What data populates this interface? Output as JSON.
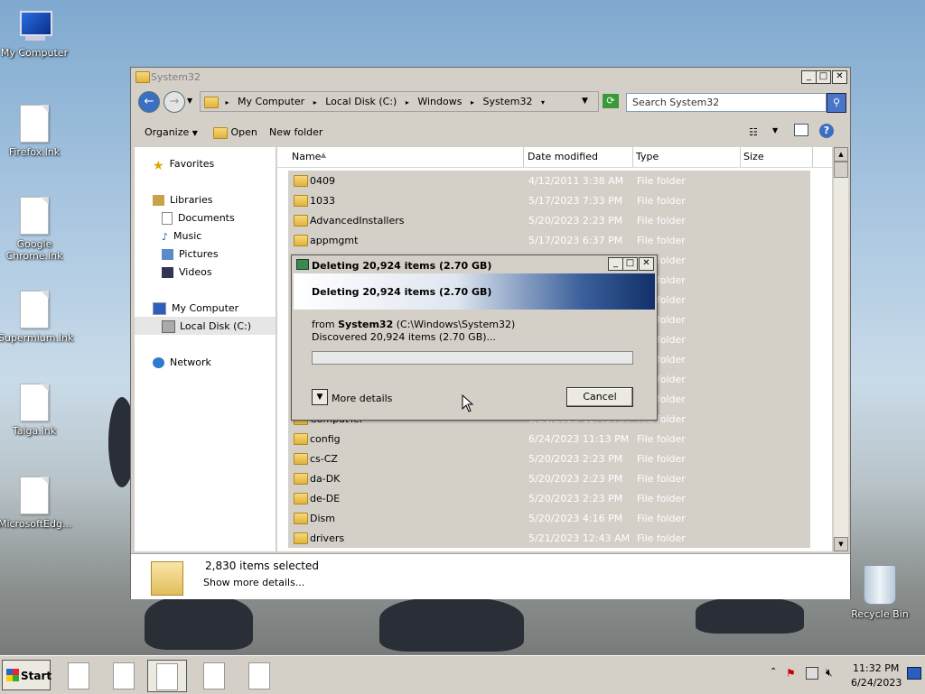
{
  "desktop": {
    "icons": [
      {
        "label": "My Computer"
      },
      {
        "label": "Firefox.lnk"
      },
      {
        "label": "Google Chrome.lnk"
      },
      {
        "label": "Supermium.lnk"
      },
      {
        "label": "Taiga.lnk"
      },
      {
        "label": "MicrosoftEdg..."
      },
      {
        "label": "Recycle Bin"
      }
    ]
  },
  "window": {
    "title": "System32",
    "controls": {
      "minimize": "_",
      "maximize": "□",
      "close": "✕"
    },
    "breadcrumb": [
      "My Computer",
      "Local Disk (C:)",
      "Windows",
      "System32"
    ],
    "search_placeholder": "Search System32",
    "toolbar": {
      "organize": "Organize",
      "open": "Open",
      "new_folder": "New folder"
    },
    "nav": {
      "favorites": "Favorites",
      "libraries": "Libraries",
      "documents": "Documents",
      "music": "Music",
      "pictures": "Pictures",
      "videos": "Videos",
      "my_computer": "My Computer",
      "local_disk": "Local Disk (C:)",
      "network": "Network"
    },
    "columns": {
      "name": "Name",
      "date": "Date modified",
      "type": "Type",
      "size": "Size"
    },
    "rows": [
      {
        "name": "0409",
        "date": "4/12/2011 3:38 AM",
        "type": "File folder"
      },
      {
        "name": "1033",
        "date": "5/17/2023 7:33 PM",
        "type": "File folder"
      },
      {
        "name": "AdvancedInstallers",
        "date": "5/20/2023 2:23 PM",
        "type": "File folder"
      },
      {
        "name": "appmgmt",
        "date": "5/17/2023 6:37 PM",
        "type": "File folder"
      },
      {
        "name": "",
        "date": "",
        "type": "File folder"
      },
      {
        "name": "",
        "date": "",
        "type": "File folder"
      },
      {
        "name": "",
        "date": "",
        "type": "File folder"
      },
      {
        "name": "",
        "date": "",
        "type": "File folder"
      },
      {
        "name": "",
        "date": "",
        "type": "File folder"
      },
      {
        "name": "",
        "date": "",
        "type": "File folder"
      },
      {
        "name": "",
        "date": "",
        "type": "File folder"
      },
      {
        "name": "",
        "date": "",
        "type": "File folder"
      },
      {
        "name": "CompatTel",
        "date": "5/21/2023 12:43 AM",
        "type": "File folder"
      },
      {
        "name": "config",
        "date": "6/24/2023 11:13 PM",
        "type": "File folder"
      },
      {
        "name": "cs-CZ",
        "date": "5/20/2023 2:23 PM",
        "type": "File folder"
      },
      {
        "name": "da-DK",
        "date": "5/20/2023 2:23 PM",
        "type": "File folder"
      },
      {
        "name": "de-DE",
        "date": "5/20/2023 2:23 PM",
        "type": "File folder"
      },
      {
        "name": "Dism",
        "date": "5/20/2023 4:16 PM",
        "type": "File folder"
      },
      {
        "name": "drivers",
        "date": "5/21/2023 12:43 AM",
        "type": "File folder"
      }
    ],
    "status": {
      "selected": "2,830 items selected",
      "details": "Show more details..."
    }
  },
  "dialog": {
    "title": "Deleting 20,924 items (2.70 GB)",
    "heading": "Deleting 20,924 items (2.70 GB)",
    "from_prefix": "from",
    "from_name": "System32",
    "from_path": "(C:\\Windows\\System32)",
    "discovered": "Discovered 20,924 items (2.70 GB)...",
    "progress": 0,
    "more_details": "More details",
    "cancel": "Cancel"
  },
  "taskbar": {
    "start": "Start",
    "time": "11:32 PM",
    "date": "6/24/2023"
  }
}
